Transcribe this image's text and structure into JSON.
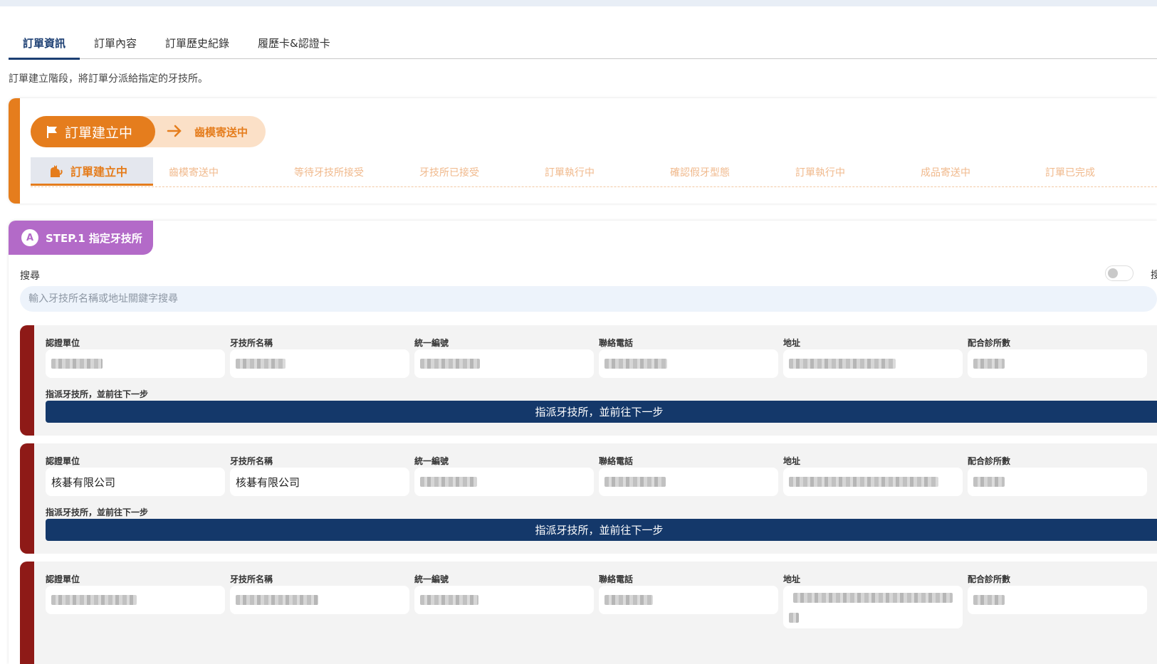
{
  "tabs": [
    {
      "label": "訂單資訊",
      "active": true
    },
    {
      "label": "訂單內容",
      "active": false
    },
    {
      "label": "訂單歷史紀錄",
      "active": false
    },
    {
      "label": "履歷卡&認證卡",
      "active": false
    }
  ],
  "description": "訂單建立階段，將訂單分派給指定的牙技所。",
  "status": {
    "current_label": "訂單建立中",
    "next_label": "齒模寄送中",
    "accent_color": "#e57d1d",
    "steps": [
      "訂單建立中",
      "齒模寄送中",
      "等待牙技所接受",
      "牙技所已接受",
      "訂單執行中",
      "確認假牙型態",
      "訂單執行中",
      "成品寄送中",
      "訂單已完成"
    ]
  },
  "step1": {
    "badge_label": "STEP.1 指定牙技所",
    "badge_color": "#b36ac8",
    "search_label": "搜尋",
    "search_placeholder": "輸入牙技所名稱或地址關鍵字搜尋",
    "toggle_label": "搜"
  },
  "lab_fields": {
    "cert_unit": "認證單位",
    "lab_name": "牙技所名稱",
    "tax_id": "統一編號",
    "phone": "聯絡電話",
    "address": "地址",
    "clinic_count": "配合診所數"
  },
  "assign_label": "指派牙技所，並前往下一步",
  "assign_button": "指派牙技所，並前往下一步",
  "labs": [
    {
      "cert_unit": "",
      "lab_name": "",
      "tax_id": "",
      "phone": "",
      "address": "",
      "clinic_count": ""
    },
    {
      "cert_unit": "核碁有限公司",
      "lab_name": "核碁有限公司",
      "tax_id": "",
      "phone": "",
      "address": "",
      "clinic_count": ""
    },
    {
      "cert_unit": "",
      "lab_name": "",
      "tax_id": "",
      "phone": "",
      "address": "",
      "clinic_count": ""
    }
  ],
  "colors": {
    "primary_navy": "#14386a",
    "lab_accent": "#8e1a17"
  }
}
